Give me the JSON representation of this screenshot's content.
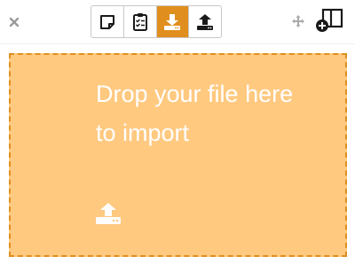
{
  "toolbar": {
    "close_icon": "close-icon",
    "modes": [
      {
        "icon": "sticky-note-icon",
        "active": false
      },
      {
        "icon": "checklist-icon",
        "active": false
      },
      {
        "icon": "download-icon",
        "active": true
      },
      {
        "icon": "upload-icon",
        "active": false
      }
    ],
    "move_icon": "move-icon",
    "add_panel_icon": "add-panel-icon"
  },
  "dropzone": {
    "message": "Drop your file here to import",
    "icon": "upload-icon"
  },
  "colors": {
    "accent": "#e08f1e",
    "dropzone_bg": "#ffc980",
    "text_on_accent": "#ffffff",
    "icon_dark": "#1a1a1a",
    "icon_muted": "#9a9a9a"
  }
}
